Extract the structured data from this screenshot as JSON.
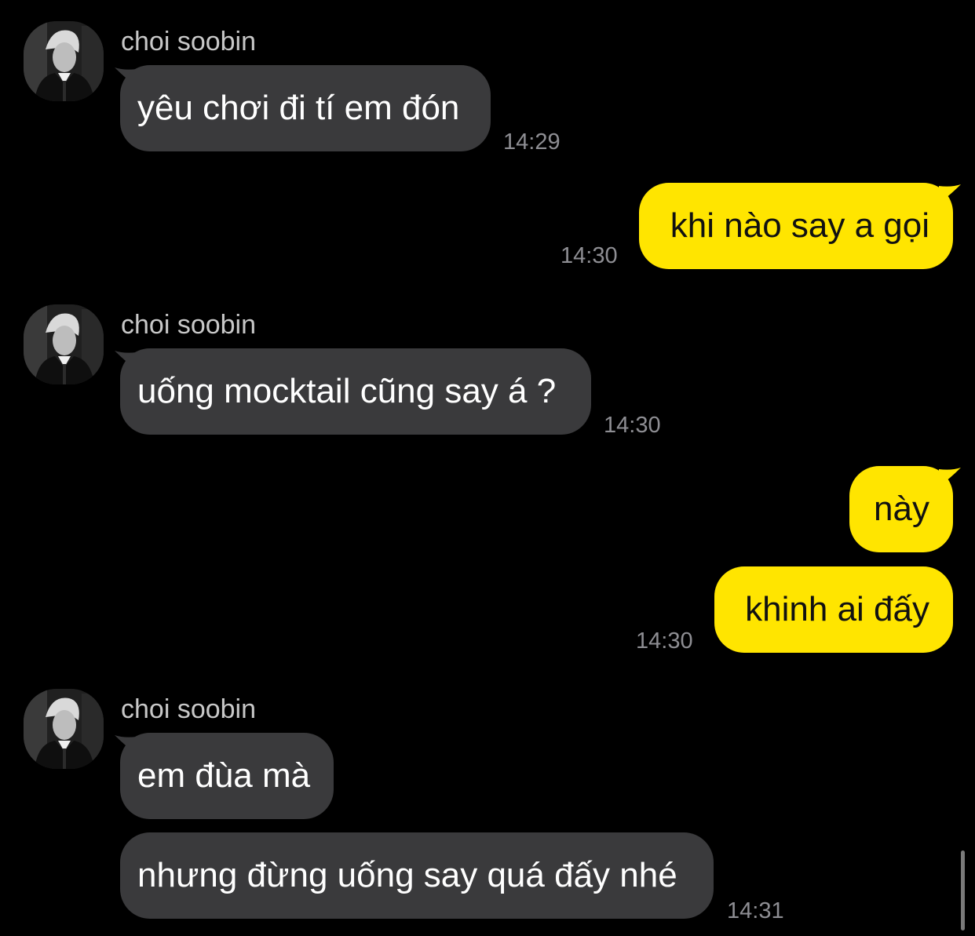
{
  "colors": {
    "background": "#000000",
    "incoming_bubble": "#3a3a3c",
    "incoming_text": "#ffffff",
    "outgoing_bubble": "#ffe500",
    "outgoing_text": "#111111",
    "sender_name": "#c8c8c8",
    "timestamp": "#8e8e93"
  },
  "contact": {
    "name": "choi soobin",
    "avatar_icon": "profile-photo-icon"
  },
  "messages": [
    {
      "direction": "incoming",
      "sender": "choi soobin",
      "text": "yêu chơi đi tí em đón",
      "time": "14:29"
    },
    {
      "direction": "outgoing",
      "text": "khi nào say a gọi",
      "time": "14:30"
    },
    {
      "direction": "incoming",
      "sender": "choi soobin",
      "text": "uống mocktail cũng say á ?",
      "time": "14:30"
    },
    {
      "direction": "outgoing",
      "text": "này",
      "time": ""
    },
    {
      "direction": "outgoing",
      "text": "khinh ai đấy",
      "time": "14:30"
    },
    {
      "direction": "incoming",
      "sender": "choi soobin",
      "text": "em đùa mà",
      "time": ""
    },
    {
      "direction": "incoming",
      "text": "nhưng đừng uống say quá đấy nhé",
      "time": "14:31"
    }
  ]
}
